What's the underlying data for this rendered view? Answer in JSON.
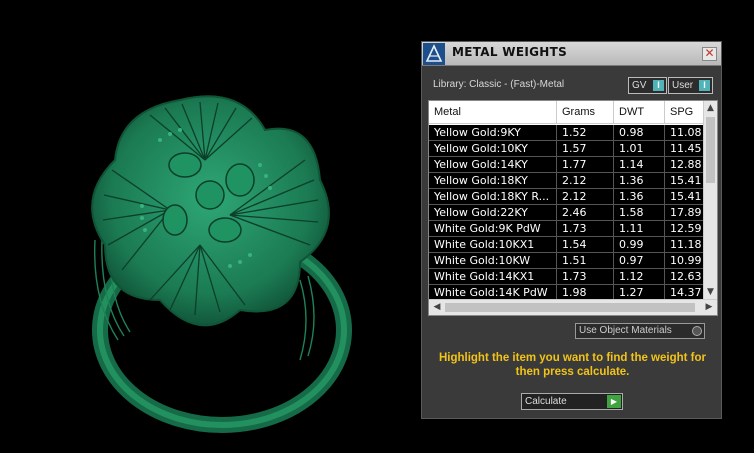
{
  "window": {
    "title": "METAL WEIGHTS",
    "close_symbol": "✕"
  },
  "library": {
    "label": "Library: Classic - (Fast)-Metal"
  },
  "toggles": {
    "gv": {
      "label": "GV",
      "knob": "I"
    },
    "user": {
      "label": "User",
      "knob": "I"
    }
  },
  "table": {
    "columns": [
      "Metal",
      "Grams",
      "DWT",
      "SPG"
    ],
    "rows": [
      [
        "Yellow Gold:9KY",
        "1.52",
        "0.98",
        "11.08"
      ],
      [
        "Yellow Gold:10KY",
        "1.57",
        "1.01",
        "11.45"
      ],
      [
        "Yellow Gold:14KY",
        "1.77",
        "1.14",
        "12.88"
      ],
      [
        "Yellow Gold:18KY",
        "2.12",
        "1.36",
        "15.41"
      ],
      [
        "Yellow Gold:18KY R...",
        "2.12",
        "1.36",
        "15.41"
      ],
      [
        "Yellow Gold:22KY",
        "2.46",
        "1.58",
        "17.89"
      ],
      [
        "White Gold:9K PdW",
        "1.73",
        "1.11",
        "12.59"
      ],
      [
        "White Gold:10KX1",
        "1.54",
        "0.99",
        "11.18"
      ],
      [
        "White Gold:10KW",
        "1.51",
        "0.97",
        "10.99"
      ],
      [
        "White Gold:14KX1",
        "1.73",
        "1.12",
        "12.63"
      ],
      [
        "White Gold:14K PdW",
        "1.98",
        "1.27",
        "14.37"
      ]
    ]
  },
  "materials_select": {
    "label": "Use Object Materials"
  },
  "instruction": "Highlight the item you want to find the weight for then press calculate.",
  "calculate_button": {
    "label": "Calculate"
  },
  "colors": {
    "ring": "#1f8a5e",
    "instruction_text": "#f2c318",
    "toggle_knob": "#4fb3b8",
    "play_button": "#3fa33f"
  }
}
